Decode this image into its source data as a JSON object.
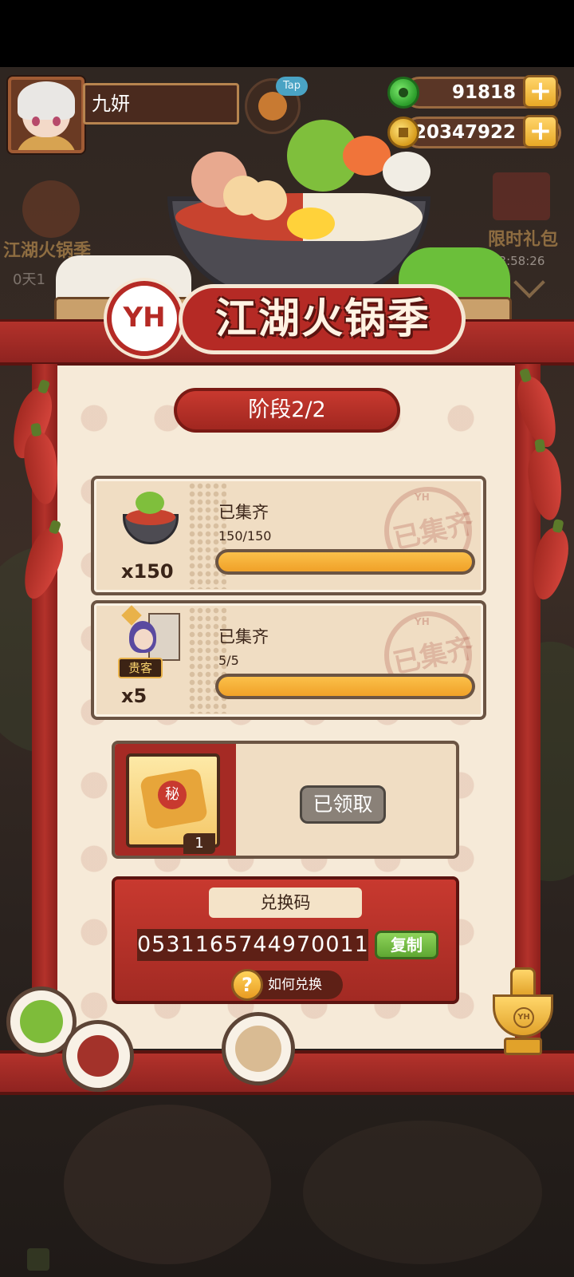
{
  "player": {
    "name": "九妍"
  },
  "hud": {
    "tip_badge": "Tap",
    "jade_amount": "91818",
    "coin_amount": "20347922",
    "add_label": "+"
  },
  "side": {
    "left_event_label": "江湖火锅季",
    "left_event_timer": "0天1",
    "right_gift_label": "限时礼包",
    "right_gift_timer": "23:58:26"
  },
  "event": {
    "logo": "YH",
    "title": "江湖火锅季"
  },
  "stage": {
    "label": "阶段2/2"
  },
  "tasks": [
    {
      "icon": "hotpot-icon",
      "count": "x150",
      "title": "已集齐",
      "progress_text": "150/150",
      "progress": 1.0,
      "stamp_text": "已集齐",
      "stamp_yh": "YH"
    },
    {
      "icon": "vip-guest-icon",
      "tag": "贵客",
      "count": "x5",
      "title": "已集齐",
      "progress_text": "5/5",
      "progress": 1.0,
      "stamp_text": "已集齐",
      "stamp_yh": "YH"
    }
  ],
  "reward": {
    "item_seal": "秘",
    "quantity": "1",
    "status_button": "已领取"
  },
  "redeem": {
    "label": "兑换码",
    "code": "0531165744970011",
    "copy_button": "复制",
    "howto_icon": "?",
    "howto_button": "如何兑换"
  },
  "trophy": {
    "mark": "YH"
  },
  "colors": {
    "brand_red": "#b52a25",
    "panel_bg": "#f6ead8",
    "progress_orange": "#f0a128",
    "copy_green": "#5ea732",
    "claimed_gray": "#8a8178"
  }
}
